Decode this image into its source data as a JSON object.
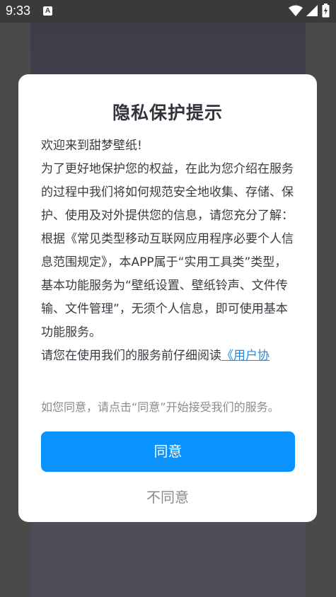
{
  "status_bar": {
    "time": "9:33",
    "notification_icon": "A",
    "icons": [
      "wifi-icon",
      "signal-icon",
      "battery-icon"
    ]
  },
  "dialog": {
    "title": "隐私保护提示",
    "paragraphs": [
      "欢迎来到甜梦壁纸!",
      "为了更好地保护您的权益，在此为您介绍在服务的过程中我们将如何规范安全地收集、存储、保护、使用及对外提供您的信息，请您充分了解：",
      "根据《常见类型移动互联网应用程序必要个人信息范围规定》，本APP属于“实用工具类”类型，基本功能服务为“壁纸设置、壁纸铃声、文件传输、文件管理”，无须个人信息，即可使用基本功能服务。"
    ],
    "read_prompt": "请您在使用我们的服务前仔细阅读",
    "agreement_link": "《用户协",
    "consent_note": "如您同意，请点击“同意”开始接受我们的服务。",
    "agree_label": "同意",
    "disagree_label": "不同意"
  },
  "colors": {
    "accent": "#0a92ff",
    "link": "#1a8cf0",
    "overlay": "#4a4a4a"
  }
}
